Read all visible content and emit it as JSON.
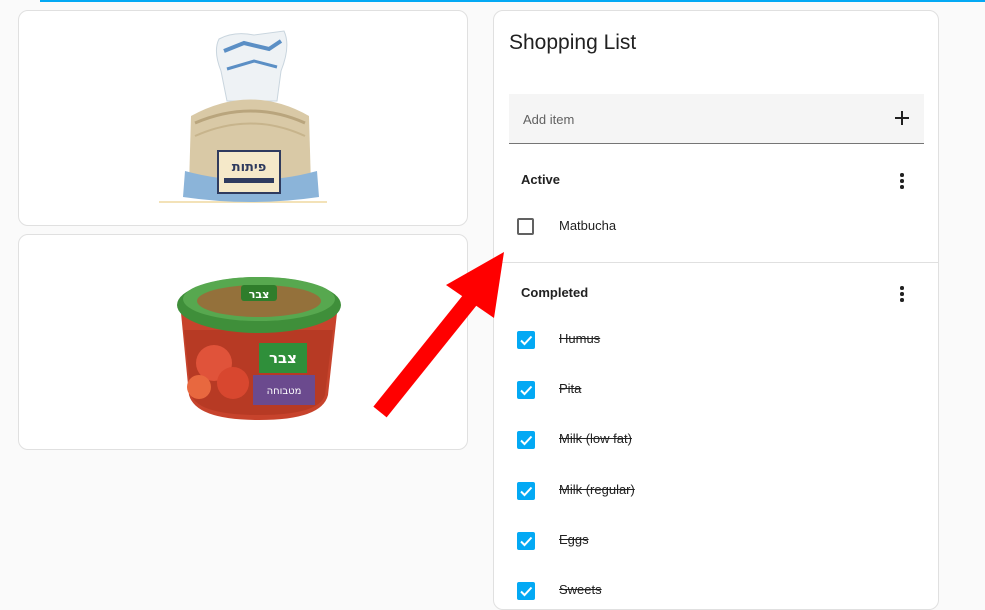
{
  "shopping_list": {
    "title": "Shopping List",
    "add_placeholder": "Add item",
    "active_header": "Active",
    "completed_header": "Completed",
    "active_items": [
      "Matbucha"
    ],
    "completed_items": [
      "Humus",
      "Pita",
      "Milk (low fat)",
      "Milk (regular)",
      "Eggs",
      "Sweets"
    ]
  },
  "product_images": {
    "pita_bag_text": "פיתות",
    "matbucha_brand_text": "צבר",
    "matbucha_label_text": "מטבוחה"
  },
  "colors": {
    "accent": "#03a9f4",
    "arrow": "#ff0000"
  }
}
